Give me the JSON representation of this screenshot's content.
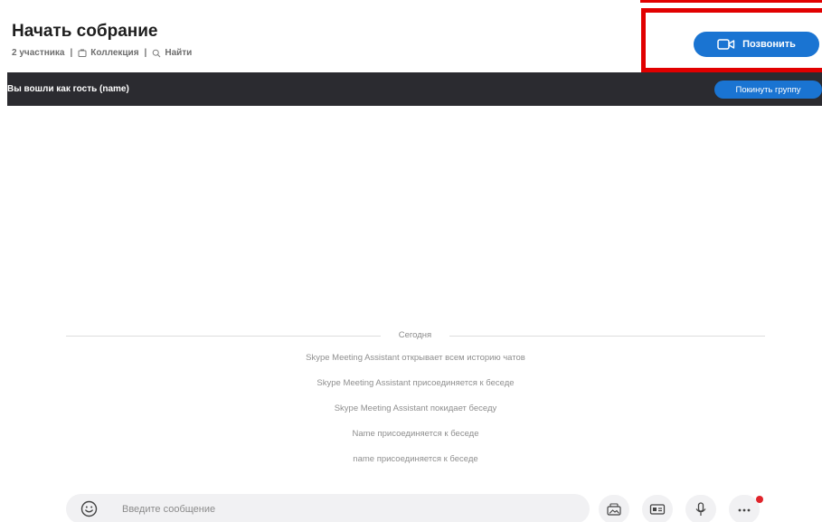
{
  "header": {
    "title": "Начать собрание",
    "participants": "2 участника",
    "gallery_label": "Коллекция",
    "find_label": "Найти",
    "separator": "|",
    "call_button_label": "Позвонить"
  },
  "guest_bar": {
    "message": "Вы вошли как гость (name)",
    "leave_button_label": "Покинуть группу"
  },
  "conversation": {
    "day_label": "Сегодня",
    "events": [
      "Skype Meeting Assistant открывает всем историю чатов",
      "Skype Meeting Assistant присоединяется к беседе",
      "Skype Meeting Assistant покидает беседу",
      "Name присоединяется к беседе",
      "name присоединяется к беседе"
    ]
  },
  "composer": {
    "placeholder": "Введите сообщение",
    "actions": [
      "emoji-icon",
      "media-icon",
      "contact-card-icon",
      "microphone-icon",
      "more-icon"
    ]
  },
  "colors": {
    "accent": "#1a74d2",
    "guest_bar_bg": "#2b2b30",
    "highlight": "#e10000",
    "notification": "#e0242b"
  }
}
